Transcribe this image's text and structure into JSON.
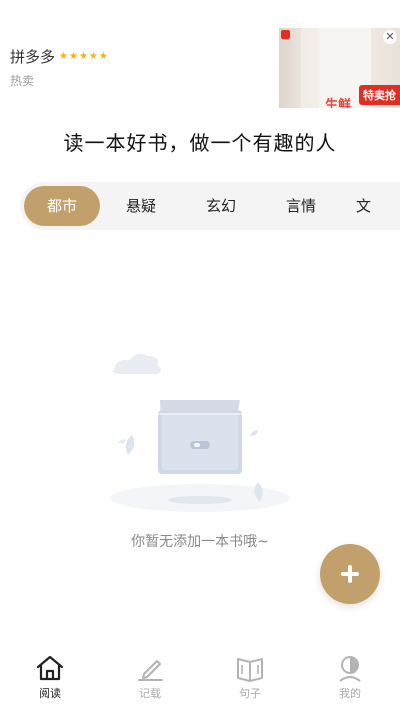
{
  "ad": {
    "advertiser": "拼多多",
    "rating_stars": "★★★★★",
    "subtitle": "热卖",
    "image_text": "生鲜",
    "tag": "特卖抢",
    "close_symbol": "✕"
  },
  "slogan": "读一本好书，做一个有趣的人",
  "tabs": [
    {
      "label": "都市",
      "active": true
    },
    {
      "label": "悬疑"
    },
    {
      "label": "玄幻"
    },
    {
      "label": "言情"
    },
    {
      "label": "文"
    }
  ],
  "empty_state": {
    "message": "你暂无添加一本书哦~"
  },
  "fab": {
    "icon": "plus-icon"
  },
  "bottom_nav": [
    {
      "label": "阅读",
      "icon": "home-icon",
      "active": true
    },
    {
      "label": "记载",
      "icon": "pen-icon"
    },
    {
      "label": "句子",
      "icon": "book-icon"
    },
    {
      "label": "我的",
      "icon": "profile-icon"
    }
  ],
  "colors": {
    "accent": "#c2a06b",
    "tab_background": "#f4f4f4",
    "nav_inactive": "#aaaaaa",
    "nav_active": "#222222"
  }
}
